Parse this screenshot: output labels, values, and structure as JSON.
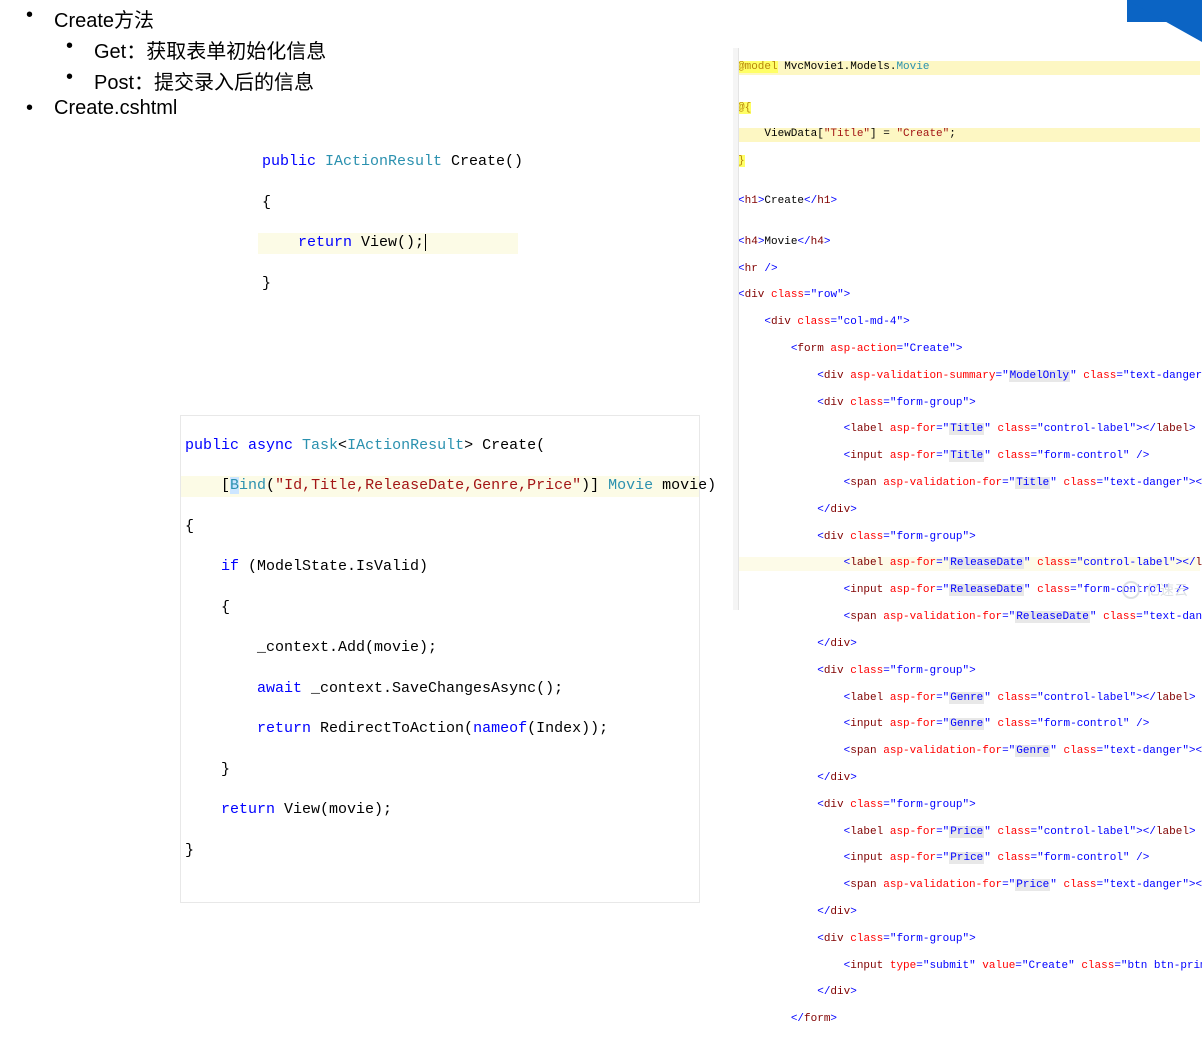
{
  "bullets": {
    "l1a": "Create方法",
    "l2a": "Get：获取表单初始化信息",
    "l2b": "Post：提交录入后的信息",
    "l1b": "Create.cshtml"
  },
  "code1": {
    "l1_kw": "public ",
    "l1_type": "IActionResult",
    "l1_rest": " Create()",
    "l2": "{",
    "l3_kw": "    return",
    "l3_rest": " View();",
    "l4": "}"
  },
  "code2": {
    "l1_kw1": "public ",
    "l1_kw2": "async ",
    "l1_type1": "Task",
    "l1_ang1": "<",
    "l1_type2": "IActionResult",
    "l1_ang2": ">",
    "l1_rest": " Create(",
    "l2_pre": "    [",
    "l2_bind": "B",
    "l2_bind2": "ind",
    "l2_paren": "(",
    "l2_str": "\"Id,Title,ReleaseDate,Genre,Price\"",
    "l2_paren2": ")] ",
    "l2_type": "Movie",
    "l2_rest": " movie)",
    "l3": "{",
    "l4_kw": "    if ",
    "l4_rest": "(ModelState.IsValid)",
    "l5": "    {",
    "l6": "        _context.Add(movie);",
    "l7_kw": "        await ",
    "l7_rest": "_context.SaveChangesAsync();",
    "l8_kw": "        return ",
    "l8_m": "RedirectToAction(",
    "l8_kw2": "nameof",
    "l8_rest": "(Index));",
    "l9": "    }",
    "l10_kw": "    return ",
    "l10_rest": "View(movie);",
    "l11": "}"
  },
  "rcode": {
    "r1_a": "@model",
    "r1_b": " MvcMovie1.Models.",
    "r1_c": "Movie",
    "r2": "",
    "r3": "@{",
    "r4_a": "    ViewData[",
    "r4_b": "\"Title\"",
    "r4_c": "] = ",
    "r4_d": "\"Create\"",
    "r4_e": ";",
    "r5": "}",
    "r6": "",
    "h1o": "<",
    "h1t": "h1",
    "h1c": ">",
    "h1txt": "Create",
    "h1o2": "</",
    "h1c2": ">",
    "r8": "",
    "h4o": "<",
    "h4t": "h4",
    "h4c": ">",
    "h4txt": "Movie",
    "h4o2": "</",
    "h4c2": ">",
    "hro": "<",
    "hrt": "hr ",
    "hrc": "/>",
    "dv": "div",
    "sp": "span",
    "lb": "label",
    "inp": "input",
    "frm": "form",
    "cls": " class",
    "eq": "=",
    "q": "\"",
    "row": "row",
    "col": "col-md-4",
    "aspact": " asp-action",
    "create": "Create",
    "aspvs": " asp-validation-summary",
    "mo": "ModelOnly",
    "td": "text-danger",
    "fg": "form-group",
    "cl": "control-label",
    "fc": "form-control",
    "aspfor": " asp-for",
    "aspvf": " asp-validation-for",
    "Title": "Title",
    "RD": "ReleaseDate",
    "Genre": "Genre",
    "Price": "Price",
    "typ": " type",
    "sub": "submit",
    "valAttr": " value",
    "btn": "btn btn-primary",
    "lt": "<",
    "gt": ">",
    "lts": "</",
    "sc": " />"
  },
  "watermark": "亿速云"
}
